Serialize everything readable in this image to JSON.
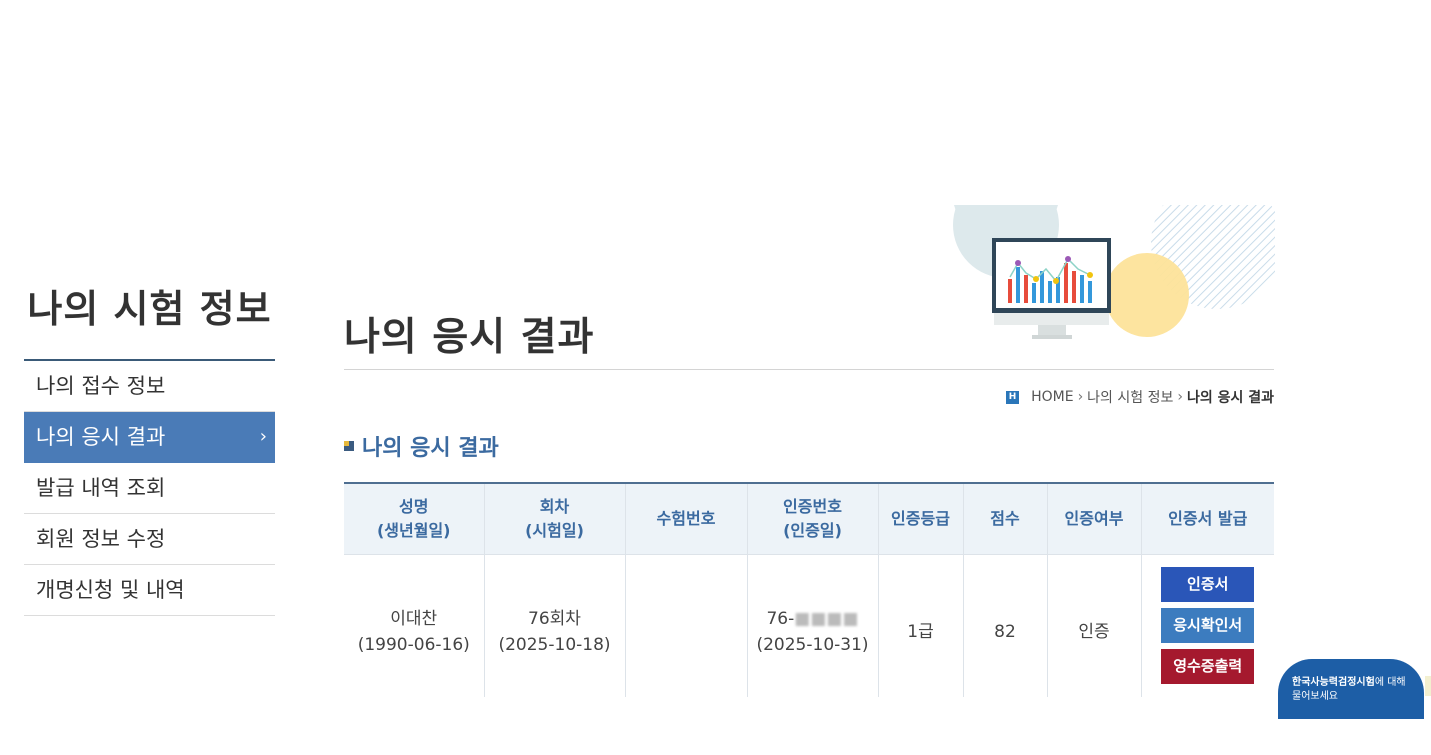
{
  "sidebar": {
    "title": "나의 시험 정보",
    "items": [
      {
        "label": "나의 접수 정보"
      },
      {
        "label": "나의 응시 결과",
        "active": true
      },
      {
        "label": "발급 내역 조회"
      },
      {
        "label": "회원 정보 수정"
      },
      {
        "label": "개명신청 및 내역"
      }
    ]
  },
  "header": {
    "page_title": "나의 응시 결과",
    "breadcrumb": [
      "HOME",
      "나의 시험 정보",
      "나의 응시 결과"
    ]
  },
  "section_title": "나의 응시 결과",
  "table": {
    "headers": [
      {
        "line1": "성명",
        "line2": "(생년월일)"
      },
      {
        "line1": "회차",
        "line2": "(시험일)"
      },
      {
        "line1": "수험번호",
        "line2": ""
      },
      {
        "line1": "인증번호",
        "line2": "(인증일)"
      },
      {
        "line1": "인증등급",
        "line2": ""
      },
      {
        "line1": "점수",
        "line2": ""
      },
      {
        "line1": "인증여부",
        "line2": ""
      },
      {
        "line1": "인증서 발급",
        "line2": ""
      }
    ],
    "row": {
      "name": "이대찬",
      "birthdate": "(1990-06-16)",
      "round": "76회차",
      "exam_date": "(2025-10-18)",
      "exam_number": "",
      "cert_number": "76-",
      "cert_date": "(2025-10-31)",
      "grade": "1급",
      "score": "82",
      "status": "인증"
    },
    "buttons": {
      "certificate": "인증서",
      "exam_confirmation": "응시확인서",
      "receipt": "영수증출력"
    }
  },
  "chat": {
    "bold_text": "한국사능력검정시험",
    "text": "에 대해",
    "line2": "물어보세요"
  },
  "colors": {
    "accent": "#4a7bb7",
    "title_blue": "#3b6aa0",
    "btn_cert": "#2a56b8",
    "btn_confirm": "#3c7cbf",
    "btn_receipt": "#a5192e"
  }
}
